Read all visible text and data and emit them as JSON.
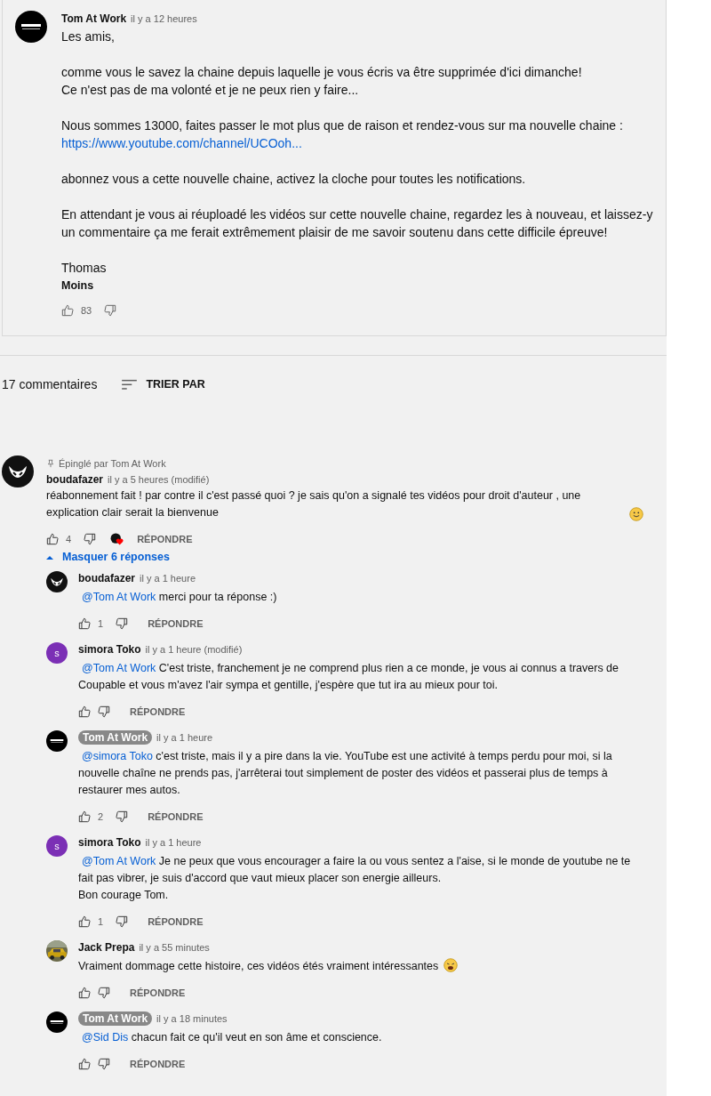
{
  "post": {
    "author": "Tom At Work",
    "time": "il y a 12 heures",
    "avatar": {
      "kind": "logo"
    },
    "paragraphs": [
      [
        {
          "kind": "text",
          "text": "Les amis,"
        }
      ],
      [
        {
          "kind": "text",
          "text": "comme vous le savez la chaine depuis laquelle je vous écris va être supprimée d'ici dimanche!"
        },
        {
          "kind": "text",
          "text": "Ce n'est pas de ma volonté et je ne peux rien y faire..."
        }
      ],
      [
        {
          "kind": "text",
          "text": "Nous sommes 13000, faites passer le mot plus que de raison et rendez-vous sur ma nouvelle chaine :"
        },
        {
          "kind": "link",
          "text": "https://www.youtube.com/channel/UCOoh..."
        }
      ],
      [
        {
          "kind": "text",
          "text": "abonnez vous a cette nouvelle chaine, activez la cloche pour toutes les notifications."
        }
      ],
      [
        {
          "kind": "text",
          "text": "En attendant je vous ai réuploadé les vidéos sur cette nouvelle chaine, regardez les à nouveau, et laissez-y un commentaire ça me ferait extrêmement plaisir de me savoir soutenu dans cette difficile épreuve!"
        }
      ],
      [
        {
          "kind": "text",
          "text": "Thomas"
        }
      ]
    ],
    "less": "Moins",
    "likes": "83"
  },
  "comments_header": {
    "count": "17 commentaires",
    "sort": "TRIER PAR"
  },
  "pinned": {
    "pinned_by": "Épinglé par Tom At Work",
    "author": "boudafazer",
    "owner": false,
    "time": "il y a 5 heures (modifié)",
    "avatar": {
      "kind": "skull"
    },
    "text": "réabonnement fait ! par contre il c'est passé quoi ? je sais qu'on a signalé tes vidéos pour droit d'auteur , une explication clair serait la bienvenue",
    "emoji": {
      "kind": "smile"
    },
    "likes": "4",
    "hearted": true,
    "reply": "RÉPONDRE",
    "toggle": {
      "label": "Masquer 6 réponses",
      "expanded": true
    }
  },
  "replies": [
    {
      "author": "boudafazer",
      "owner": false,
      "time": "il y a 1 heure",
      "avatar": {
        "kind": "skull"
      },
      "mention": "@Tom At Work",
      "text": "merci pour ta réponse :)",
      "likes": "1",
      "reply": "RÉPONDRE"
    },
    {
      "author": "simora Toko",
      "owner": false,
      "time": "il y a 1 heure (modifié)",
      "avatar": {
        "kind": "letter",
        "initial": "s"
      },
      "mention": "@Tom At Work",
      "text": "C'est triste, franchement je ne comprend plus rien a ce monde, je vous ai connus a travers de Coupable et vous m'avez l'air sympa et gentille, j'espère que tut ira au mieux pour toi.",
      "reply": "RÉPONDRE"
    },
    {
      "author": "Tom At Work",
      "owner": true,
      "time": "il y a 1 heure",
      "avatar": {
        "kind": "logo"
      },
      "mention": "@simora Toko",
      "text": "c'est triste, mais il y a pire dans la vie. YouTube est une activité à temps perdu pour moi, si la nouvelle chaîne ne prends pas, j'arrêterai tout simplement de poster des vidéos et passerai plus de temps à restaurer mes autos.",
      "likes": "2",
      "reply": "RÉPONDRE"
    },
    {
      "author": "simora Toko",
      "owner": false,
      "time": "il y a 1 heure",
      "avatar": {
        "kind": "letter",
        "initial": "s"
      },
      "mention": "@Tom At Work",
      "text": "Je ne peux que vous encourager a faire la ou vous sentez a l'aise, si le monde de youtube ne te fait pas vibrer, je suis d'accord que vaut mieux placer son energie ailleurs.\nBon courage Tom.",
      "likes": "1",
      "reply": "RÉPONDRE"
    },
    {
      "author": "Jack Prepa",
      "owner": false,
      "time": "il y a 55 minutes",
      "text": "Vraiment dommage cette histoire, ces vidéos étés vraiment intéressantes",
      "emoji": {
        "kind": "weary"
      },
      "reply": "RÉPONDRE"
    },
    {
      "author": "Tom At Work",
      "owner": true,
      "time": "il y a 18 minutes",
      "avatar": {
        "kind": "logo"
      },
      "mention": "@Sid Dis",
      "text": "chacun fait ce qu'il veut en son âme et conscience.",
      "reply": "RÉPONDRE"
    }
  ]
}
